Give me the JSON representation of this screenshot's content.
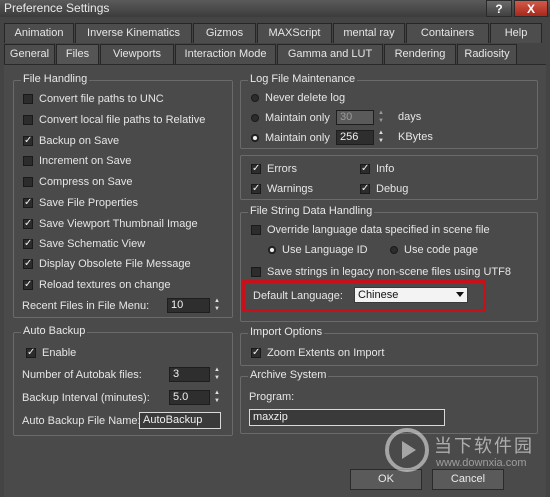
{
  "window": {
    "title": "Preference Settings",
    "help_button": "?",
    "close_button": "X"
  },
  "tabs_row1": [
    "Animation",
    "Inverse Kinematics",
    "Gizmos",
    "MAXScript",
    "mental ray",
    "Containers",
    "Help"
  ],
  "tabs_row2": [
    "General",
    "Files",
    "Viewports",
    "Interaction Mode",
    "Gamma and LUT",
    "Rendering",
    "Radiosity"
  ],
  "active_tab": "Files",
  "file_handling": {
    "title": "File Handling",
    "options": [
      {
        "label": "Convert file paths to UNC",
        "checked": false
      },
      {
        "label": "Convert local file paths to Relative",
        "checked": false
      },
      {
        "label": "Backup on Save",
        "checked": true
      },
      {
        "label": "Increment on Save",
        "checked": false
      },
      {
        "label": "Compress on Save",
        "checked": false
      },
      {
        "label": "Save File Properties",
        "checked": true
      },
      {
        "label": "Save Viewport Thumbnail Image",
        "checked": true
      },
      {
        "label": "Save Schematic View",
        "checked": true
      },
      {
        "label": "Display Obsolete File Message",
        "checked": true
      },
      {
        "label": "Reload textures on change",
        "checked": true
      }
    ],
    "recent_files_label": "Recent Files in File Menu:",
    "recent_files_value": "10"
  },
  "auto_backup": {
    "title": "Auto Backup",
    "enable_label": "Enable",
    "enable_checked": true,
    "number_label": "Number of Autobak files:",
    "number_value": "3",
    "interval_label": "Backup Interval (minutes):",
    "interval_value": "5.0",
    "name_label": "Auto Backup File Name:",
    "name_value": "AutoBackup"
  },
  "log_file": {
    "title": "Log File Maintenance",
    "never_delete": "Never delete log",
    "maintain_only_1": "Maintain only",
    "days_value": "30",
    "days_unit": "days",
    "maintain_only_2": "Maintain only",
    "kbytes_value": "256",
    "kbytes_unit": "KBytes",
    "selected": "kbytes",
    "errors": "Errors",
    "info": "Info",
    "warnings": "Warnings",
    "debug": "Debug"
  },
  "file_string": {
    "title": "File String Data Handling",
    "override_label": "Override language data specified in scene file",
    "use_language_id": "Use Language ID",
    "use_code_page": "Use code page",
    "legacy_label": "Save strings in legacy non-scene files using UTF8",
    "default_language_label": "Default Language:",
    "default_language_value": "Chinese"
  },
  "import_options": {
    "title": "Import Options",
    "zoom_label": "Zoom Extents on Import"
  },
  "archive": {
    "title": "Archive System",
    "program_label": "Program:",
    "program_value": "maxzip"
  },
  "footer": {
    "ok": "OK",
    "cancel": "Cancel"
  },
  "watermark": {
    "text": "当下软件园",
    "url": "www.downxia.com"
  },
  "colors": {
    "highlight": "#c8101a",
    "background": "#4a4a4a"
  }
}
